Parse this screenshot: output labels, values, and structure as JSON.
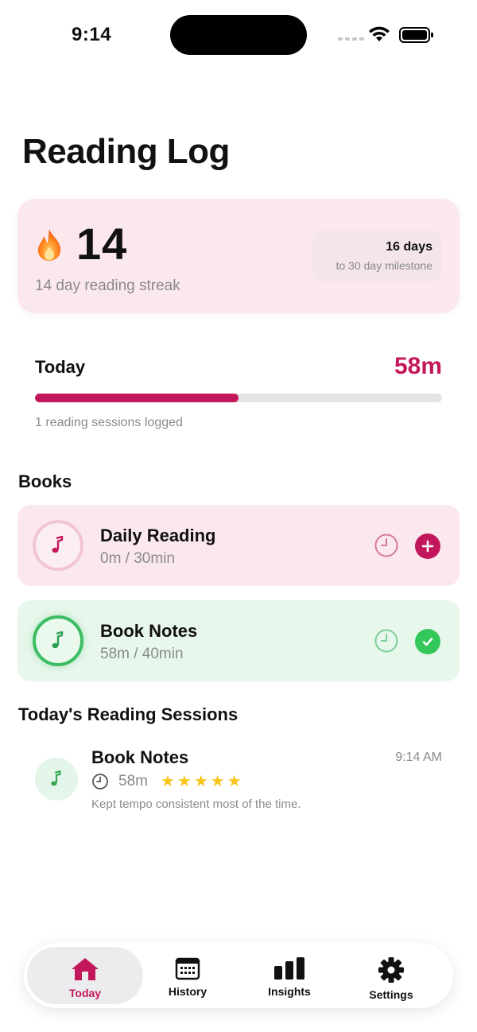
{
  "status_bar": {
    "time": "9:14"
  },
  "page": {
    "title": "Reading Log"
  },
  "streak": {
    "count": "14",
    "label": "14 day reading streak",
    "milestone_days": "16 days",
    "milestone_sub": "to 30 day milestone"
  },
  "today": {
    "label": "Today",
    "value": "58m",
    "progress_fraction": 0.5,
    "sessions_text": "1 reading sessions logged"
  },
  "books_section": {
    "title": "Books",
    "items": [
      {
        "name": "Daily Reading",
        "progress": "0m / 30min",
        "icon": "music-note-icon",
        "action": "add",
        "color": "#c2185b"
      },
      {
        "name": "Book Notes",
        "progress": "58m / 40min",
        "icon": "music-note-icon",
        "action": "done",
        "color": "#34c759"
      }
    ]
  },
  "sessions_section": {
    "title": "Today's Reading Sessions",
    "items": [
      {
        "name": "Book Notes",
        "time": "9:14 AM",
        "duration": "58m",
        "rating": 5,
        "note": "Kept tempo consistent most of the time."
      }
    ]
  },
  "tab_bar": {
    "tabs": [
      {
        "label": "Today",
        "icon": "home-icon",
        "active": true
      },
      {
        "label": "History",
        "icon": "calendar-icon",
        "active": false
      },
      {
        "label": "Insights",
        "icon": "bar-chart-icon",
        "active": false
      },
      {
        "label": "Settings",
        "icon": "gear-icon",
        "active": false
      }
    ]
  },
  "colors": {
    "accent": "#c2185b",
    "success": "#34c759",
    "star": "#f5c518"
  }
}
